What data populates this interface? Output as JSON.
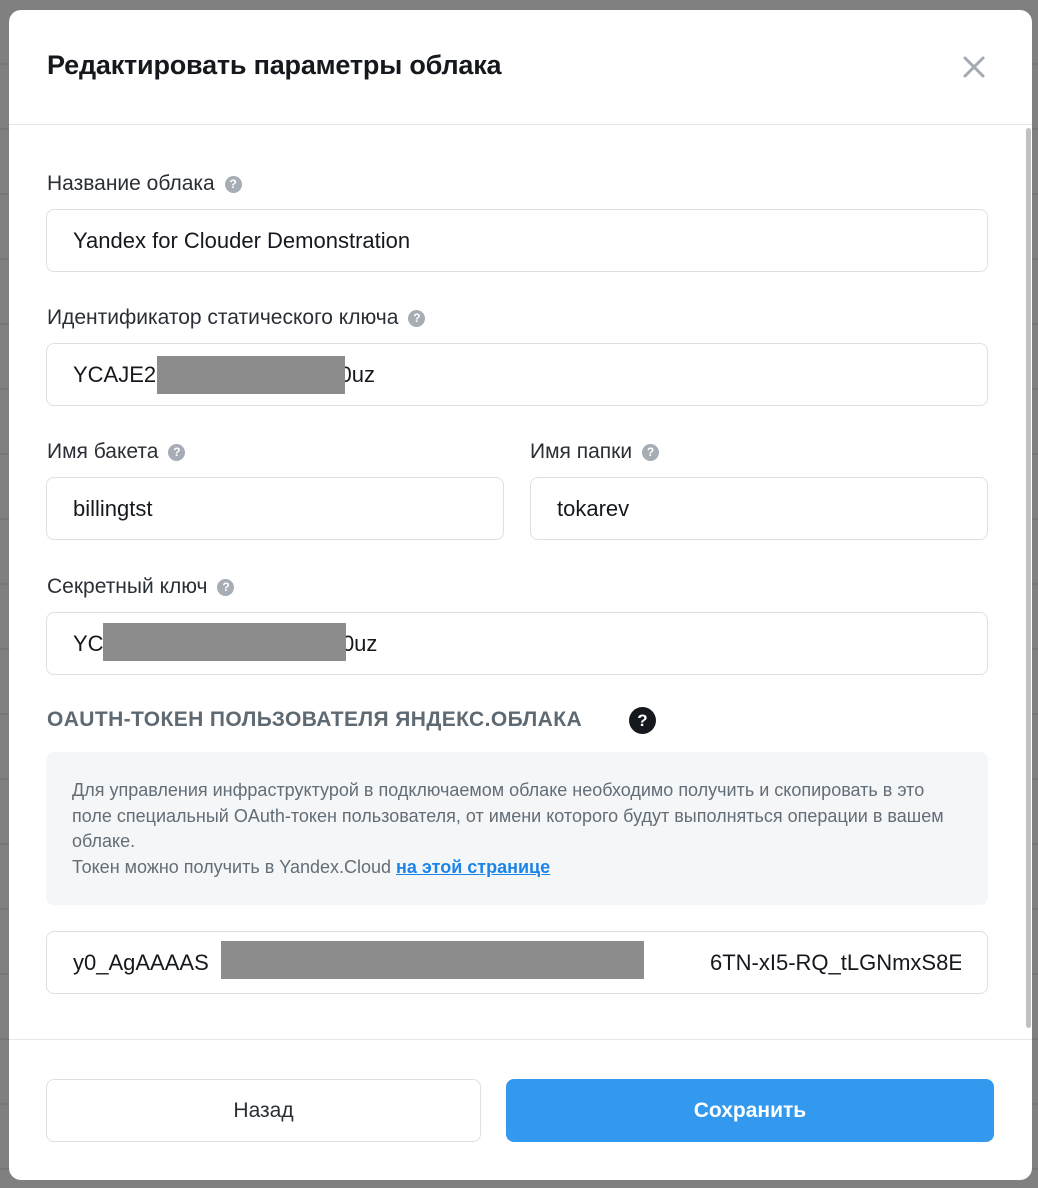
{
  "modal": {
    "title": "Редактировать параметры облака",
    "close_icon": "close-icon"
  },
  "fields": {
    "cloud_name": {
      "label": "Название облака",
      "value": "Yandex for Clouder Demonstration"
    },
    "static_key_id": {
      "label": "Идентификатор статического ключа",
      "value": "YCAJE2                              0uz"
    },
    "bucket_name": {
      "label": "Имя бакета",
      "value": "billingtst"
    },
    "folder_name": {
      "label": "Имя папки",
      "value": "tokarev"
    },
    "secret_key": {
      "label": "Секретный ключ",
      "value": "YC                                       0uz"
    },
    "oauth_token": {
      "value": "y0_AgAAAAS                                                                                  6TN-xI5-RQ_tLGNmxS8E"
    }
  },
  "help_glyph": "?",
  "oauth_section": {
    "heading": "OAUTH-ТОКЕН ПОЛЬЗОВАТЕЛЯ ЯНДЕКС.ОБЛАКА",
    "info_text": "Для управления инфраструктурой в подключаемом облаке необходимо получить и скопировать в это поле специальный OAuth-токен пользователя, от имени которого будут выполняться операции в вашем облаке.",
    "info_text_2": "Токен можно получить в Yandex.Cloud ",
    "link_text": "на этой странице"
  },
  "footer": {
    "back_label": "Назад",
    "save_label": "Сохранить"
  },
  "colors": {
    "primary": "#3399ee",
    "link": "#1b84e7",
    "mask": "#8c8c8c"
  }
}
